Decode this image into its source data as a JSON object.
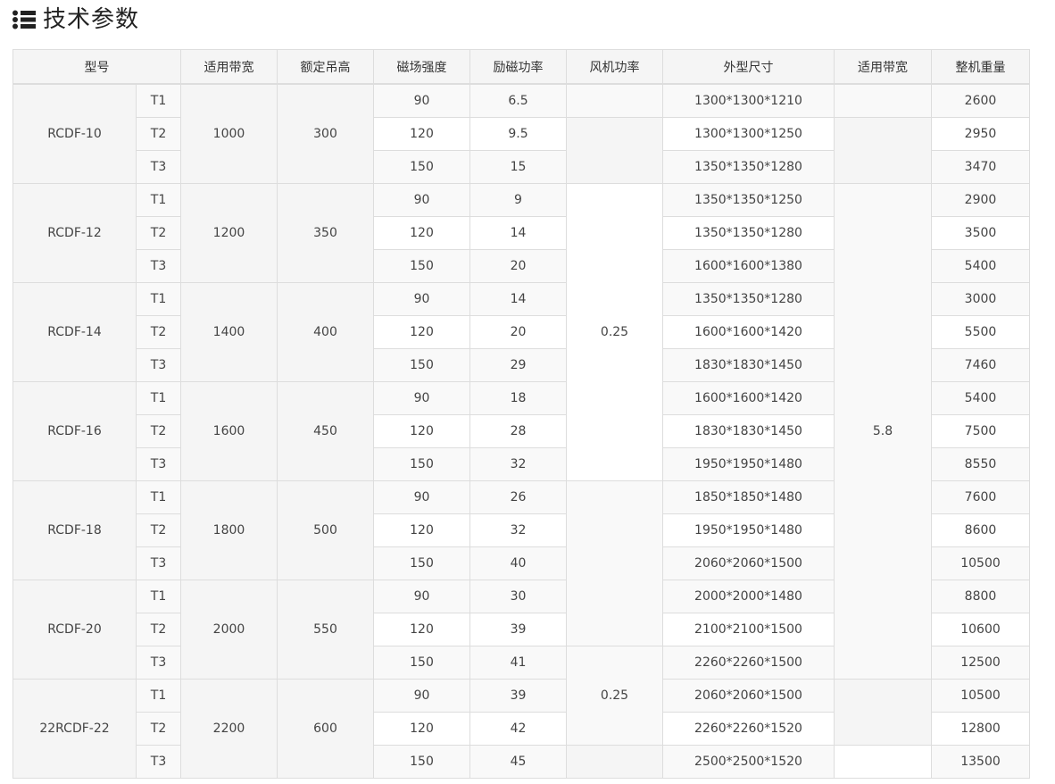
{
  "heading": {
    "title": "技术参数",
    "icon": "list-icon"
  },
  "table": {
    "headers": [
      "型号",
      "适用带宽",
      "额定吊高",
      "磁场强度",
      "励磁功率",
      "风机功率",
      "外型尺寸",
      "适用带宽",
      "整机重量"
    ],
    "groups": [
      {
        "model": "RCDF-10",
        "width": "1000",
        "height": "300",
        "rows": [
          {
            "t": "T1",
            "field": "90",
            "power": "6.5",
            "size": "1300*1300*1210",
            "weight": "2600"
          },
          {
            "t": "T2",
            "field": "120",
            "power": "9.5",
            "size": "1300*1300*1250",
            "weight": "2950"
          },
          {
            "t": "T3",
            "field": "150",
            "power": "15",
            "size": "1350*1350*1280",
            "weight": "3470"
          }
        ]
      },
      {
        "model": "RCDF-12",
        "width": "1200",
        "height": "350",
        "rows": [
          {
            "t": "T1",
            "field": "90",
            "power": "9",
            "size": "1350*1350*1250",
            "weight": "2900"
          },
          {
            "t": "T2",
            "field": "120",
            "power": "14",
            "size": "1350*1350*1280",
            "weight": "3500"
          },
          {
            "t": "T3",
            "field": "150",
            "power": "20",
            "size": "1600*1600*1380",
            "weight": "5400"
          }
        ]
      },
      {
        "model": "RCDF-14",
        "width": "1400",
        "height": "400",
        "rows": [
          {
            "t": "T1",
            "field": "90",
            "power": "14",
            "size": "1350*1350*1280",
            "weight": "3000"
          },
          {
            "t": "T2",
            "field": "120",
            "power": "20",
            "size": "1600*1600*1420",
            "weight": "5500"
          },
          {
            "t": "T3",
            "field": "150",
            "power": "29",
            "size": "1830*1830*1450",
            "weight": "7460"
          }
        ]
      },
      {
        "model": "RCDF-16",
        "width": "1600",
        "height": "450",
        "rows": [
          {
            "t": "T1",
            "field": "90",
            "power": "18",
            "size": "1600*1600*1420",
            "weight": "5400"
          },
          {
            "t": "T2",
            "field": "120",
            "power": "28",
            "size": "1830*1830*1450",
            "weight": "7500"
          },
          {
            "t": "T3",
            "field": "150",
            "power": "32",
            "size": "1950*1950*1480",
            "weight": "8550"
          }
        ]
      },
      {
        "model": "RCDF-18",
        "width": "1800",
        "height": "500",
        "rows": [
          {
            "t": "T1",
            "field": "90",
            "power": "26",
            "size": "1850*1850*1480",
            "weight": "7600"
          },
          {
            "t": "T2",
            "field": "120",
            "power": "32",
            "size": "1950*1950*1480",
            "weight": "8600"
          },
          {
            "t": "T3",
            "field": "150",
            "power": "40",
            "size": "2060*2060*1500",
            "weight": "10500"
          }
        ]
      },
      {
        "model": "RCDF-20",
        "width": "2000",
        "height": "550",
        "rows": [
          {
            "t": "T1",
            "field": "90",
            "power": "30",
            "size": "2000*2000*1480",
            "weight": "8800"
          },
          {
            "t": "T2",
            "field": "120",
            "power": "39",
            "size": "2100*2100*1500",
            "weight": "10600"
          },
          {
            "t": "T3",
            "field": "150",
            "power": "41",
            "size": "2260*2260*1500",
            "weight": "12500"
          }
        ]
      },
      {
        "model": "22RCDF-22",
        "width": "2200",
        "height": "600",
        "rows": [
          {
            "t": "T1",
            "field": "90",
            "power": "39",
            "size": "2060*2060*1500",
            "weight": "10500"
          },
          {
            "t": "T2",
            "field": "120",
            "power": "42",
            "size": "2260*2260*1520",
            "weight": "12800"
          },
          {
            "t": "T3",
            "field": "150",
            "power": "45",
            "size": "2500*2500*1520",
            "weight": "13500"
          }
        ]
      }
    ],
    "fan_power_1": "0.25",
    "fan_power_2": "0.25",
    "band_width_value": "5.8"
  }
}
